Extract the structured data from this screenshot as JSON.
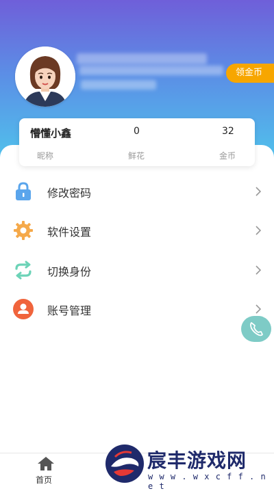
{
  "header": {
    "coin_button_label": "领金币"
  },
  "stats": {
    "nickname_value": "懵懂小鑫",
    "nickname_label": "昵称",
    "flowers_value": "0",
    "flowers_label": "鲜花",
    "coins_value": "32",
    "coins_label": "金币"
  },
  "menu": {
    "items": [
      {
        "label": "修改密码",
        "icon": "lock-icon"
      },
      {
        "label": "软件设置",
        "icon": "gear-icon"
      },
      {
        "label": "切换身份",
        "icon": "switch-icon"
      },
      {
        "label": "账号管理",
        "icon": "user-icon"
      }
    ]
  },
  "floating": {
    "icon": "phone-icon"
  },
  "tabbar": {
    "home_label": "首页"
  },
  "watermark": {
    "text": "宸丰游戏网",
    "url": "w w w . w x c f f . n e t"
  },
  "colors": {
    "header_top": "#6f5fd9",
    "header_bottom": "#4fc6ec",
    "coin_button": "#f7a600",
    "lock_icon": "#5aa5ec",
    "gear_icon": "#f5a94a",
    "switch_icon": "#6cd3b7",
    "user_icon": "#f0643c",
    "fab": "#7ecbc6"
  }
}
